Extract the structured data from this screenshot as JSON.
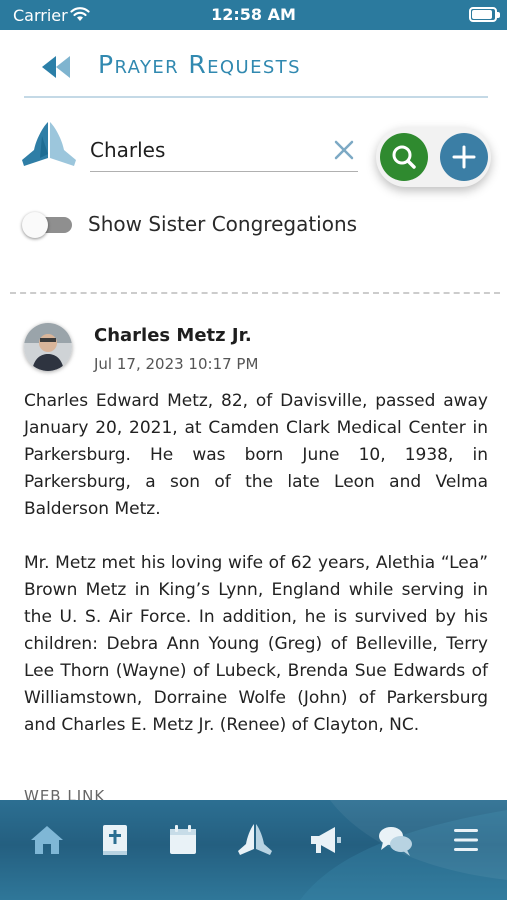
{
  "status_bar": {
    "carrier": "Carrier",
    "time": "12:58 AM"
  },
  "header": {
    "title": "Prayer Requests",
    "back_icon": "back-double-chevron-icon"
  },
  "search": {
    "value": "Charles",
    "placeholder": "",
    "clear_icon": "close-icon",
    "search_icon": "search-icon",
    "add_icon": "plus-icon"
  },
  "toggle": {
    "label": "Show Sister Congregations",
    "on": false
  },
  "post": {
    "author": "Charles Metz Jr.",
    "date": "Jul 17, 2023 10:17 PM",
    "paragraphs": [
      "Charles Edward Metz, 82, of Davisville, passed away January 20, 2021, at Camden Clark Medical Center in Parkersburg. He was born June 10, 1938, in Parkersburg, a son of the late Leon and Velma Balderson Metz.",
      "Mr. Metz met his loving wife of 62 years, Alethia “Lea” Brown Metz in King’s Lynn, England while serving in the U. S. Air Force. In addition, he is survived by his children: Debra Ann Young (Greg) of Belleville, Terry Lee Thorn (Wayne) of Lubeck, Brenda Sue Edwards of Williamstown, Dorraine Wolfe (John) of Parkersburg and Charles E. Metz Jr. (Renee) of Clayton, NC."
    ],
    "link_label": "WEB LINK"
  },
  "tab_bar": {
    "items": [
      "home-icon",
      "bible-icon",
      "calendar-icon",
      "praying-hands-icon",
      "megaphone-icon",
      "chat-bubbles-icon",
      "menu-icon"
    ]
  },
  "colors": {
    "status_bar": "#2b7a9e",
    "title": "#3189b0",
    "search_button": "#2f8a2f",
    "add_button": "#3b7ea5",
    "tab_bar": "#2c6f92"
  }
}
